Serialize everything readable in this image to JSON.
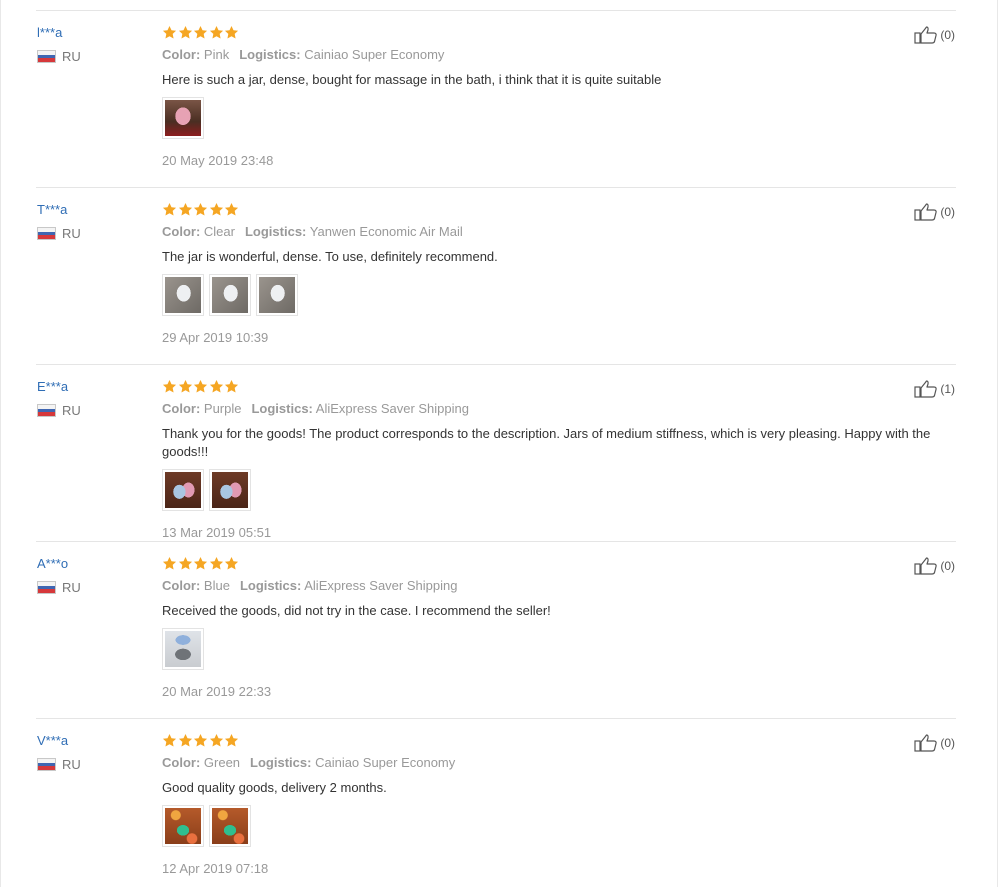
{
  "reviews": [
    {
      "user": "l***a",
      "country": "RU",
      "color_label": "Color:",
      "color": "Pink",
      "logistics_label": "Logistics:",
      "logistics": "Cainiao Super Economy",
      "text": "Here is such a jar, dense, bought for massage in the bath, i think that it is quite suitable",
      "photos": [
        "pink-jar-photo"
      ],
      "date": "20 May 2019 23:48",
      "helpful": "(0)"
    },
    {
      "user": "T***a",
      "country": "RU",
      "color_label": "Color:",
      "color": "Clear",
      "logistics_label": "Logistics:",
      "logistics": "Yanwen Economic Air Mail",
      "text": "The jar is wonderful, dense. To use, definitely recommend.",
      "photos": [
        "clear-jar-photo",
        "clear-jar-photo",
        "clear-jar-photo"
      ],
      "date": "29 Apr 2019 10:39",
      "helpful": "(0)"
    },
    {
      "user": "E***a",
      "country": "RU",
      "color_label": "Color:",
      "color": "Purple",
      "logistics_label": "Logistics:",
      "logistics": "AliExpress Saver Shipping",
      "text": "Thank you for the goods! The product corresponds to the description. Jars of medium stiffness, which is very pleasing. Happy with the goods!!!",
      "photos": [
        "purple-jar-photo",
        "purple-jar-photo"
      ],
      "date": "13 Mar 2019 05:51",
      "helpful": "(1)"
    },
    {
      "user": "A***o",
      "country": "RU",
      "color_label": "Color:",
      "color": "Blue",
      "logistics_label": "Logistics:",
      "logistics": "AliExpress Saver Shipping",
      "text": "Received the goods, did not try in the case. I recommend the seller!",
      "photos": [
        "blue-jar-photo"
      ],
      "date": "20 Mar 2019 22:33",
      "helpful": "(0)"
    },
    {
      "user": "V***a",
      "country": "RU",
      "color_label": "Color:",
      "color": "Green",
      "logistics_label": "Logistics:",
      "logistics": "Cainiao Super Economy",
      "text": "Good quality goods, delivery 2 months.",
      "photos": [
        "green-jar-photo",
        "green-jar-photo"
      ],
      "date": "12 Apr 2019 07:18",
      "helpful": "(0)"
    }
  ],
  "rating": 5,
  "colors": {
    "star": "#f5a623",
    "link": "#2f6db5",
    "muted": "#999999"
  },
  "icons": {
    "star": "star-icon",
    "thumb": "thumbs-up-icon",
    "flag": "russia-flag-icon"
  }
}
